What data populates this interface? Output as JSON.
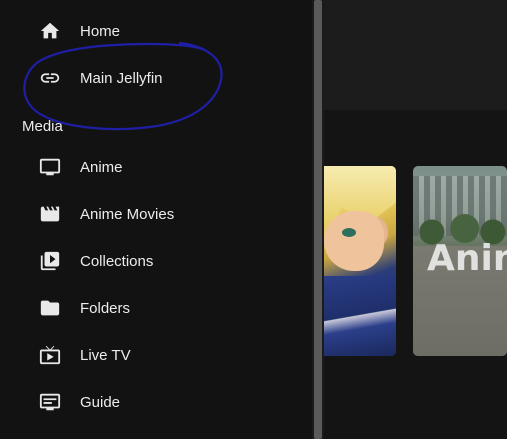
{
  "nav": {
    "top_items": [
      {
        "label": "Home",
        "icon": "home-icon"
      },
      {
        "label": "Main Jellyfin",
        "icon": "link-icon"
      }
    ],
    "section_title": "Media",
    "media_items": [
      {
        "label": "Anime",
        "icon": "tv-icon"
      },
      {
        "label": "Anime Movies",
        "icon": "movie-icon"
      },
      {
        "label": "Collections",
        "icon": "collections-icon"
      },
      {
        "label": "Folders",
        "icon": "folder-icon"
      },
      {
        "label": "Live TV",
        "icon": "live-tv-icon"
      },
      {
        "label": "Guide",
        "icon": "guide-icon"
      }
    ]
  },
  "content": {
    "cards": [
      {
        "title": ""
      },
      {
        "title": "Anim"
      }
    ]
  },
  "colors": {
    "drawer_bg": "#121212",
    "annotation": "#1f1fa6",
    "text": "#ececec"
  }
}
